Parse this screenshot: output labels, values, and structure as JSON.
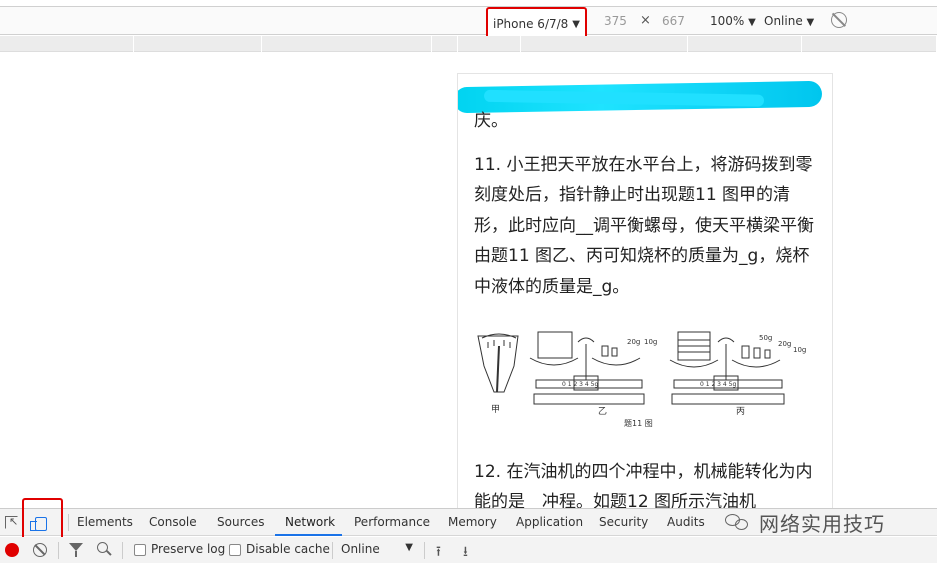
{
  "device_toolbar": {
    "device": "iPhone 6/7/8",
    "width": "375",
    "times": "×",
    "height": "667",
    "zoom": "100%",
    "throttle": "Online"
  },
  "page": {
    "partial_line": "庆。",
    "q11": "11. 小王把天平放在水平台上，将游码拨到零刻度处后，指针静止时出现题11 图甲的清形，此时应向__调平衡螺母，使天平横梁平衡由题11 图乙、丙可知烧杯的质量为_g，烧杯中液体的质量是_g。",
    "figure_labels": {
      "jia": "甲",
      "yi": "乙",
      "bing": "丙",
      "caption": "题11 图",
      "w1": "20g",
      "w2": "10g",
      "w3": "50g",
      "w4": "20g",
      "w5": "10g",
      "scale": "0 1 2 3 4 5g"
    },
    "q12": "12.  在汽油机的四个冲程中，机械能转化为内能的是__冲程。如题12 图所示汽油机"
  },
  "devtools": {
    "tabs": [
      "Elements",
      "Console",
      "Sources",
      "Network",
      "Performance",
      "Memory",
      "Application",
      "Security",
      "Audits"
    ],
    "active_tab": "Network",
    "watermark": "网络实用技巧"
  },
  "network_toolbar": {
    "preserve_log": "Preserve log",
    "disable_cache": "Disable cache",
    "throttle": "Online"
  }
}
